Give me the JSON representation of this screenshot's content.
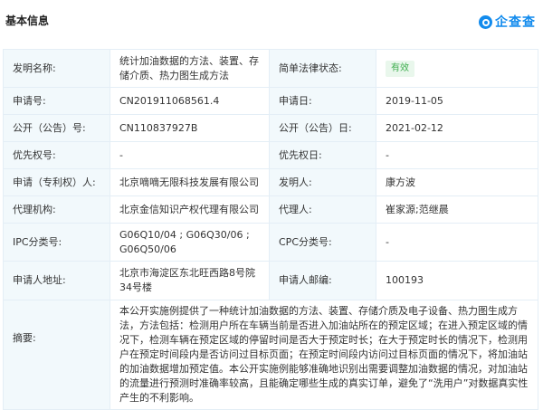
{
  "header": {
    "title": "基本信息",
    "logo_text": "企查查"
  },
  "rows": {
    "invention_name": {
      "label": "发明名称:",
      "value": "统计加油数据的方法、装置、存储介质、热力图生成方法"
    },
    "legal_status": {
      "label": "简单法律状态:",
      "value": "有效"
    },
    "app_no": {
      "label": "申请号:",
      "value": "CN201911068561.4"
    },
    "app_date": {
      "label": "申请日:",
      "value": "2019-11-05"
    },
    "pub_no": {
      "label": "公开（公告）号:",
      "value": "CN110837927B"
    },
    "pub_date": {
      "label": "公开（公告）日:",
      "value": "2021-02-12"
    },
    "priority_no": {
      "label": "优先权号:",
      "value": "-"
    },
    "priority_date": {
      "label": "优先权日:",
      "value": "-"
    },
    "applicant": {
      "label": "申请（专利权）人:",
      "value": "北京嘀嘀无限科技发展有限公司"
    },
    "inventor": {
      "label": "发明人:",
      "value": "康方波"
    },
    "agency": {
      "label": "代理机构:",
      "value": "北京金信知识产权代理有限公司"
    },
    "agent": {
      "label": "代理人:",
      "value": "崔家源;范继晨"
    },
    "ipc": {
      "label": "IPC分类号:",
      "value": "G06Q10/04 ;  G06Q30/06 ;  G06Q50/06"
    },
    "cpc": {
      "label": "CPC分类号:",
      "value": "-"
    },
    "address": {
      "label": "申请人地址:",
      "value": "北京市海淀区东北旺西路8号院34号楼"
    },
    "postcode": {
      "label": "申请人邮编:",
      "value": "100193"
    },
    "abstract": {
      "label": "摘要:",
      "value": "本公开实施例提供了一种统计加油数据的方法、装置、存储介质及电子设备、热力图生成方法，方法包括：检测用户所在车辆当前是否进入加油站所在的预定区域；在进入预定区域的情况下，检测车辆在预定区域的停留时间是否大于预定时长；在大于预定时长的情况下，检测用户在预定时间段内是否访问过目标页面；在预定时间段内访问过目标页面的情况下，将加油站的加油数据增加预定值。本公开实施例能够准确地识别出需要调整加油数据的情况，对加油站的流量进行预测时准确率较高，且能确定哪些生成的真实订单，避免了“洗用户”对数据真实性产生的不利影响。"
    }
  },
  "colors": {
    "accent": "#128bed",
    "label_bg": "#f2f9fc",
    "status_green": "#3fae4f"
  }
}
